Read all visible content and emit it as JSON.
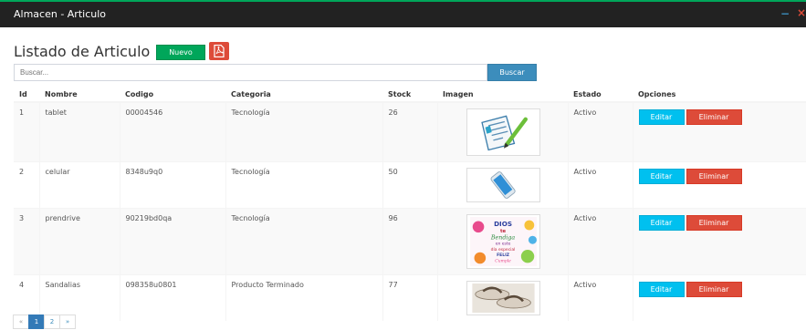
{
  "window": {
    "title": "Almacen - Articulo",
    "minimize_glyph": "−",
    "close_glyph": "×"
  },
  "header": {
    "title": "Listado de Articulo",
    "nuevo_label": "Nuevo",
    "pdf_icon": "pdf-file-icon"
  },
  "search": {
    "placeholder": "Buscar...",
    "value": "",
    "button_label": "Buscar"
  },
  "table": {
    "columns": [
      "Id",
      "Nombre",
      "Codigo",
      "Categoria",
      "Stock",
      "Imagen",
      "Estado",
      "Opciones"
    ],
    "rows": [
      {
        "id": "1",
        "nombre": "tablet",
        "codigo": "00004546",
        "categoria": "Tecnología",
        "stock": "26",
        "imagen": "document-pencil-image",
        "estado": "Activo"
      },
      {
        "id": "2",
        "nombre": "celular",
        "codigo": "8348u9q0",
        "categoria": "Tecnología",
        "stock": "50",
        "imagen": "cellphone-image",
        "estado": "Activo"
      },
      {
        "id": "3",
        "nombre": "prendrive",
        "codigo": "90219bd0qa",
        "categoria": "Tecnología",
        "stock": "96",
        "imagen": "greeting-card-image",
        "estado": "Activo"
      },
      {
        "id": "4",
        "nombre": "Sandalias",
        "codigo": "098358u0801",
        "categoria": "Producto Terminado",
        "stock": "77",
        "imagen": "sandals-image",
        "estado": "Activo"
      }
    ],
    "editar_label": "Editar",
    "eliminar_label": "Eliminar"
  },
  "card_text": [
    "DIOS",
    "te",
    "Bendiga",
    "en este",
    "día especial",
    "FELIZ",
    "Cumple"
  ],
  "pagination": {
    "prev": "«",
    "pages": [
      "1",
      "2"
    ],
    "active_page": "1",
    "next": "»"
  },
  "colors": {
    "titlebar_bg": "#222222",
    "success": "#00a65a",
    "primary": "#3c8dbc",
    "info": "#00c0ef",
    "danger": "#dd4b39",
    "page_active": "#337ab7"
  }
}
